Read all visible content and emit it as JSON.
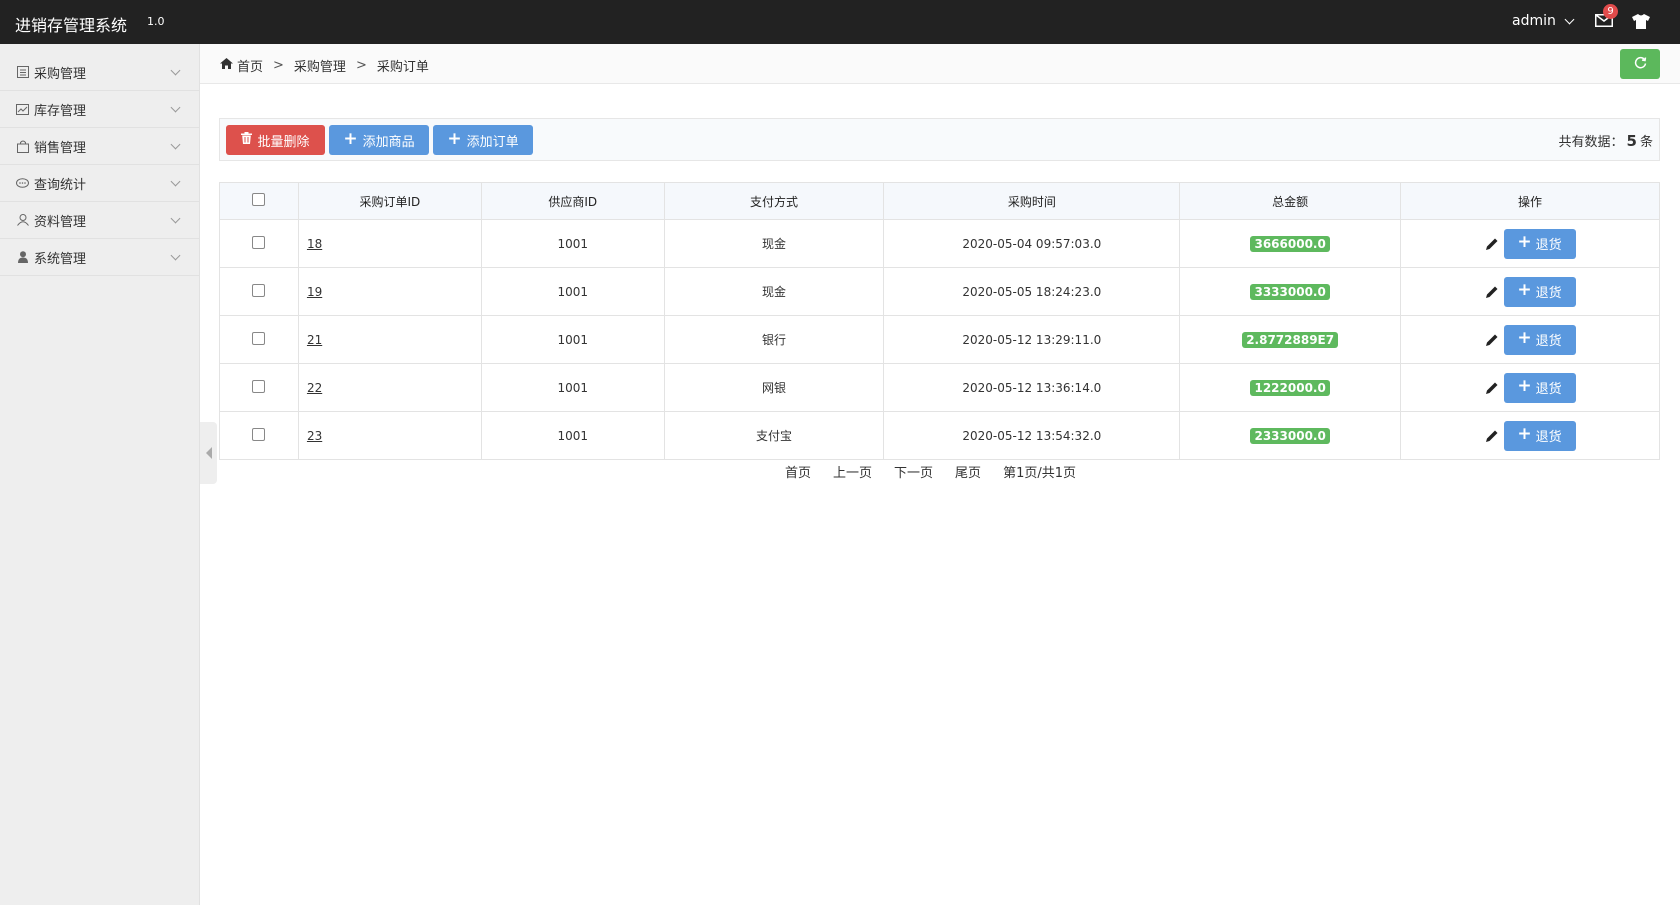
{
  "header": {
    "app_title": "进销存管理系统",
    "version": "1.0",
    "user": "admin",
    "mail_badge": "9",
    "icons": [
      "mail-icon",
      "shirt-icon",
      "chevron-down-icon"
    ]
  },
  "sidebar": {
    "items": [
      {
        "label": "采购管理",
        "icon": "purchase-icon"
      },
      {
        "label": "库存管理",
        "icon": "inventory-icon"
      },
      {
        "label": "销售管理",
        "icon": "sales-bag-icon"
      },
      {
        "label": "查询统计",
        "icon": "chat-icon"
      },
      {
        "label": "资料管理",
        "icon": "profile-icon"
      },
      {
        "label": "系统管理",
        "icon": "user-icon"
      }
    ]
  },
  "breadcrumb": {
    "home": "首页",
    "sep": ">",
    "level1": "采购管理",
    "level2": "采购订单"
  },
  "toolbar": {
    "batch_delete": "批量删除",
    "add_goods": "添加商品",
    "add_order": "添加订单",
    "total_prefix": "共有数据：",
    "total_count": "5",
    "total_suffix": "条"
  },
  "table": {
    "headers": [
      "采购订单ID",
      "供应商ID",
      "支付方式",
      "采购时间",
      "总金额",
      "操作"
    ],
    "return_label": "退货",
    "rows": [
      {
        "id": "18",
        "supplier": "1001",
        "payment": "现金",
        "time": "2020-05-04 09:57:03.0",
        "amount": "3666000.0"
      },
      {
        "id": "19",
        "supplier": "1001",
        "payment": "现金",
        "time": "2020-05-05 18:24:23.0",
        "amount": "3333000.0"
      },
      {
        "id": "21",
        "supplier": "1001",
        "payment": "银行",
        "time": "2020-05-12 13:29:11.0",
        "amount": "2.8772889E7"
      },
      {
        "id": "22",
        "supplier": "1001",
        "payment": "网银",
        "time": "2020-05-12 13:36:14.0",
        "amount": "1222000.0"
      },
      {
        "id": "23",
        "supplier": "1001",
        "payment": "支付宝",
        "time": "2020-05-12 13:54:32.0",
        "amount": "2333000.0"
      }
    ]
  },
  "pager": {
    "first": "首页",
    "prev": "上一页",
    "next": "下一页",
    "last": "尾页",
    "info": "第1页/共1页"
  },
  "colors": {
    "topbar": "#222222",
    "danger": "#dd514c",
    "primary": "#5a98de",
    "success": "#5cb85c",
    "badge": "#e14b4b"
  }
}
